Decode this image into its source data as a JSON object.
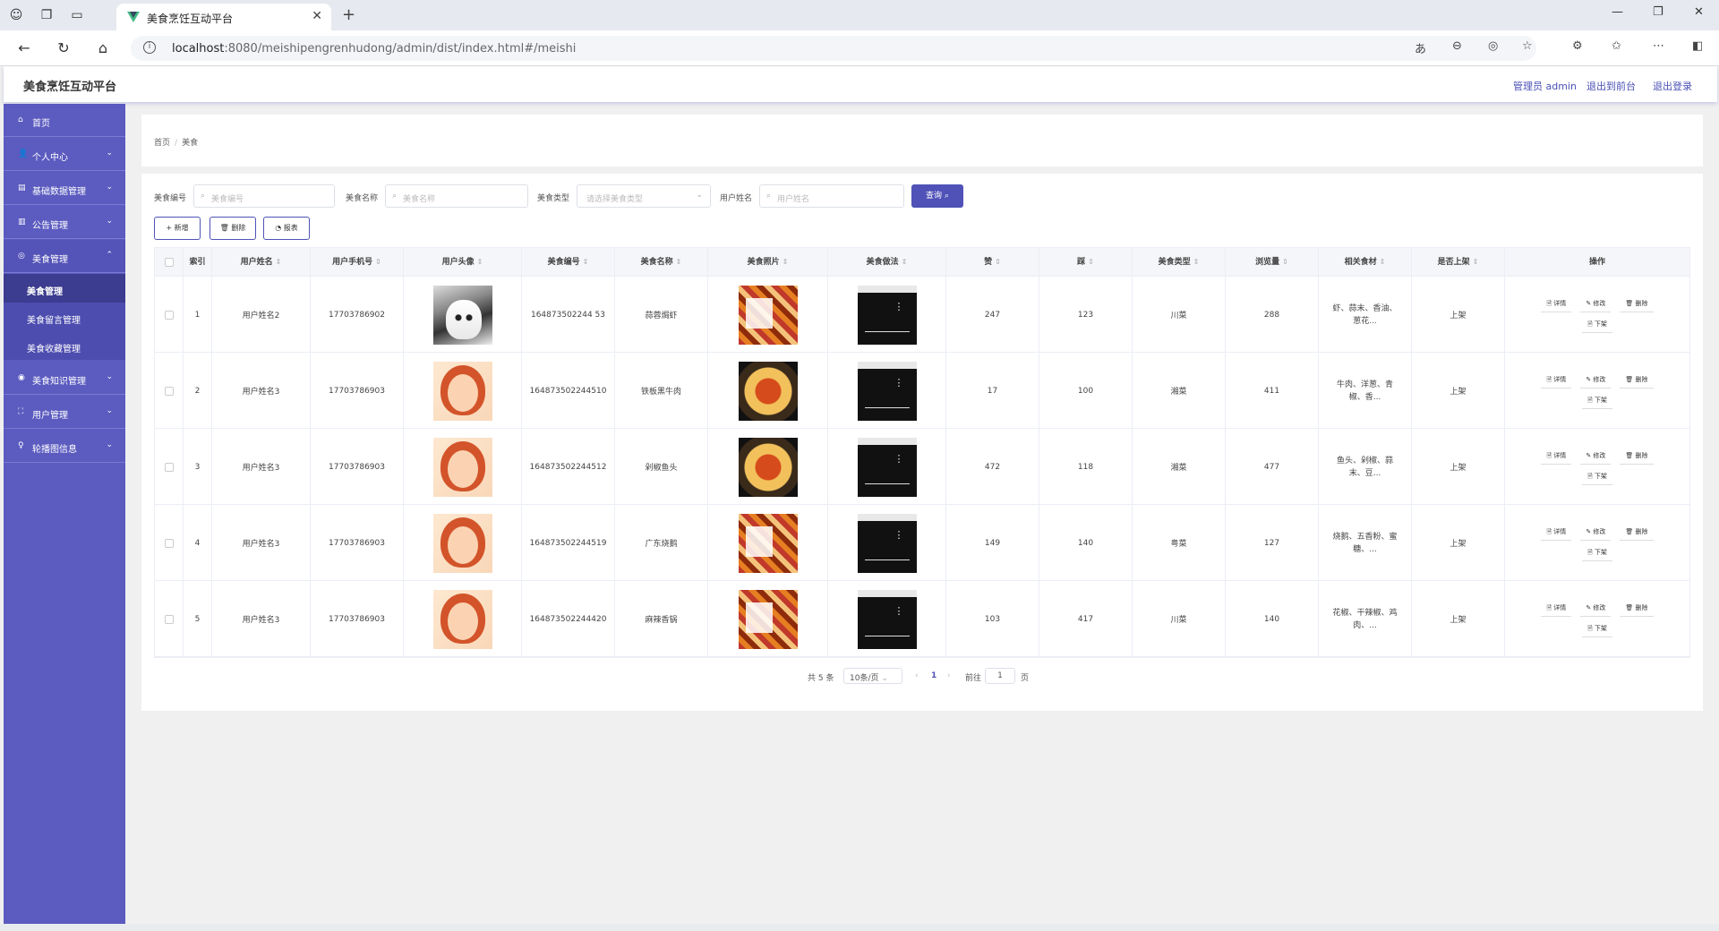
{
  "browser": {
    "tab_title": "美食烹饪互动平台",
    "url_host": "localhost",
    "url_path": ":8080/meishipengrenhudong/admin/dist/index.html#/meishi"
  },
  "header": {
    "brand": "美食烹饪互动平台",
    "admin": "管理员 admin",
    "front": "退出到前台",
    "logout": "退出登录"
  },
  "sidebar": {
    "home": "首页",
    "personal": "个人中心",
    "basedata": "基础数据管理",
    "notice": "公告管理",
    "food": "美食管理",
    "food_sub": [
      "美食管理",
      "美食留言管理",
      "美食收藏管理"
    ],
    "knowledge": "美食知识管理",
    "users": "用户管理",
    "carousel": "轮播图信息"
  },
  "breadcrumb": {
    "home": "首页",
    "current": "美食"
  },
  "search": {
    "code_label": "美食编号",
    "code_ph": "美食编号",
    "name_label": "美食名称",
    "name_ph": "美食名称",
    "type_label": "美食类型",
    "type_ph": "请选择美食类型",
    "user_label": "用户姓名",
    "user_ph": "用户姓名",
    "query": "查询 ⌕"
  },
  "actions": {
    "add": "+ 新增",
    "delete": "🗑 删除",
    "report": "◔ 报表"
  },
  "table": {
    "headers": [
      "索引",
      "用户姓名",
      "用户手机号",
      "用户头像",
      "美食编号",
      "美食名称",
      "美食照片",
      "美食做法",
      "赞",
      "踩",
      "美食类型",
      "浏览量",
      "相关食材",
      "是否上架",
      "操作"
    ],
    "rows": [
      {
        "idx": "1",
        "user": "用户姓名2",
        "phone": "17703786902",
        "avatar": "husky",
        "code": "164873502244 53",
        "name": "蒜蓉焗虾",
        "photo": "poster",
        "up": "247",
        "down": "123",
        "type": "川菜",
        "views": "288",
        "ing": "虾、蒜末、香油、葱花...",
        "shelf": "上架"
      },
      {
        "idx": "2",
        "user": "用户姓名3",
        "phone": "17703786903",
        "avatar": "girl",
        "code": "164873502244510",
        "name": "铁板黑牛肉",
        "photo": "pasta",
        "up": "17",
        "down": "100",
        "type": "湘菜",
        "views": "411",
        "ing": "牛肉、洋葱、青椒、香...",
        "shelf": "上架"
      },
      {
        "idx": "3",
        "user": "用户姓名3",
        "phone": "17703786903",
        "avatar": "girl",
        "code": "164873502244512",
        "name": "剁椒鱼头",
        "photo": "pasta",
        "up": "472",
        "down": "118",
        "type": "湘菜",
        "views": "477",
        "ing": "鱼头、剁椒、蒜末、豆...",
        "shelf": "上架"
      },
      {
        "idx": "4",
        "user": "用户姓名3",
        "phone": "17703786903",
        "avatar": "girl",
        "code": "164873502244519",
        "name": "广东烧鹅",
        "photo": "poster",
        "up": "149",
        "down": "140",
        "type": "粤菜",
        "views": "127",
        "ing": "烧鹅、五香粉、蜜糖、...",
        "shelf": "上架"
      },
      {
        "idx": "5",
        "user": "用户姓名3",
        "phone": "17703786903",
        "avatar": "girl",
        "code": "164873502244420",
        "name": "麻辣香锅",
        "photo": "poster",
        "up": "103",
        "down": "417",
        "type": "川菜",
        "views": "140",
        "ing": "花椒、干辣椒、鸡肉、...",
        "shelf": "上架"
      }
    ],
    "ops": [
      "🗎 详情",
      "✎ 修改",
      "🗑 删除",
      "🗎 下架"
    ]
  },
  "pager": {
    "total": "共 5 条",
    "size": "10条/页",
    "page": "1",
    "goto": "前往",
    "goto_val": "1",
    "unit": "页"
  }
}
